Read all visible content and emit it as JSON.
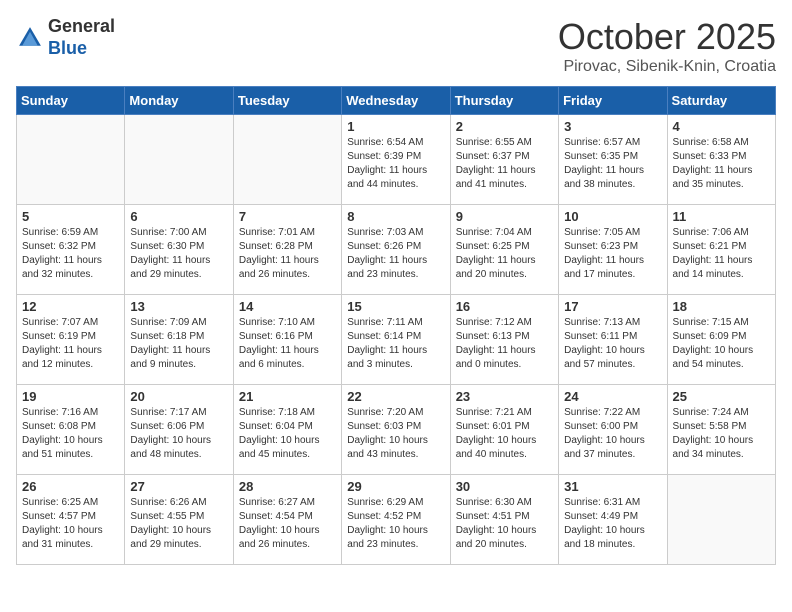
{
  "header": {
    "logo_general": "General",
    "logo_blue": "Blue",
    "month_title": "October 2025",
    "location": "Pirovac, Sibenik-Knin, Croatia"
  },
  "weekdays": [
    "Sunday",
    "Monday",
    "Tuesday",
    "Wednesday",
    "Thursday",
    "Friday",
    "Saturday"
  ],
  "weeks": [
    [
      {
        "day": "",
        "info": ""
      },
      {
        "day": "",
        "info": ""
      },
      {
        "day": "",
        "info": ""
      },
      {
        "day": "1",
        "info": "Sunrise: 6:54 AM\nSunset: 6:39 PM\nDaylight: 11 hours\nand 44 minutes."
      },
      {
        "day": "2",
        "info": "Sunrise: 6:55 AM\nSunset: 6:37 PM\nDaylight: 11 hours\nand 41 minutes."
      },
      {
        "day": "3",
        "info": "Sunrise: 6:57 AM\nSunset: 6:35 PM\nDaylight: 11 hours\nand 38 minutes."
      },
      {
        "day": "4",
        "info": "Sunrise: 6:58 AM\nSunset: 6:33 PM\nDaylight: 11 hours\nand 35 minutes."
      }
    ],
    [
      {
        "day": "5",
        "info": "Sunrise: 6:59 AM\nSunset: 6:32 PM\nDaylight: 11 hours\nand 32 minutes."
      },
      {
        "day": "6",
        "info": "Sunrise: 7:00 AM\nSunset: 6:30 PM\nDaylight: 11 hours\nand 29 minutes."
      },
      {
        "day": "7",
        "info": "Sunrise: 7:01 AM\nSunset: 6:28 PM\nDaylight: 11 hours\nand 26 minutes."
      },
      {
        "day": "8",
        "info": "Sunrise: 7:03 AM\nSunset: 6:26 PM\nDaylight: 11 hours\nand 23 minutes."
      },
      {
        "day": "9",
        "info": "Sunrise: 7:04 AM\nSunset: 6:25 PM\nDaylight: 11 hours\nand 20 minutes."
      },
      {
        "day": "10",
        "info": "Sunrise: 7:05 AM\nSunset: 6:23 PM\nDaylight: 11 hours\nand 17 minutes."
      },
      {
        "day": "11",
        "info": "Sunrise: 7:06 AM\nSunset: 6:21 PM\nDaylight: 11 hours\nand 14 minutes."
      }
    ],
    [
      {
        "day": "12",
        "info": "Sunrise: 7:07 AM\nSunset: 6:19 PM\nDaylight: 11 hours\nand 12 minutes."
      },
      {
        "day": "13",
        "info": "Sunrise: 7:09 AM\nSunset: 6:18 PM\nDaylight: 11 hours\nand 9 minutes."
      },
      {
        "day": "14",
        "info": "Sunrise: 7:10 AM\nSunset: 6:16 PM\nDaylight: 11 hours\nand 6 minutes."
      },
      {
        "day": "15",
        "info": "Sunrise: 7:11 AM\nSunset: 6:14 PM\nDaylight: 11 hours\nand 3 minutes."
      },
      {
        "day": "16",
        "info": "Sunrise: 7:12 AM\nSunset: 6:13 PM\nDaylight: 11 hours\nand 0 minutes."
      },
      {
        "day": "17",
        "info": "Sunrise: 7:13 AM\nSunset: 6:11 PM\nDaylight: 10 hours\nand 57 minutes."
      },
      {
        "day": "18",
        "info": "Sunrise: 7:15 AM\nSunset: 6:09 PM\nDaylight: 10 hours\nand 54 minutes."
      }
    ],
    [
      {
        "day": "19",
        "info": "Sunrise: 7:16 AM\nSunset: 6:08 PM\nDaylight: 10 hours\nand 51 minutes."
      },
      {
        "day": "20",
        "info": "Sunrise: 7:17 AM\nSunset: 6:06 PM\nDaylight: 10 hours\nand 48 minutes."
      },
      {
        "day": "21",
        "info": "Sunrise: 7:18 AM\nSunset: 6:04 PM\nDaylight: 10 hours\nand 45 minutes."
      },
      {
        "day": "22",
        "info": "Sunrise: 7:20 AM\nSunset: 6:03 PM\nDaylight: 10 hours\nand 43 minutes."
      },
      {
        "day": "23",
        "info": "Sunrise: 7:21 AM\nSunset: 6:01 PM\nDaylight: 10 hours\nand 40 minutes."
      },
      {
        "day": "24",
        "info": "Sunrise: 7:22 AM\nSunset: 6:00 PM\nDaylight: 10 hours\nand 37 minutes."
      },
      {
        "day": "25",
        "info": "Sunrise: 7:24 AM\nSunset: 5:58 PM\nDaylight: 10 hours\nand 34 minutes."
      }
    ],
    [
      {
        "day": "26",
        "info": "Sunrise: 6:25 AM\nSunset: 4:57 PM\nDaylight: 10 hours\nand 31 minutes."
      },
      {
        "day": "27",
        "info": "Sunrise: 6:26 AM\nSunset: 4:55 PM\nDaylight: 10 hours\nand 29 minutes."
      },
      {
        "day": "28",
        "info": "Sunrise: 6:27 AM\nSunset: 4:54 PM\nDaylight: 10 hours\nand 26 minutes."
      },
      {
        "day": "29",
        "info": "Sunrise: 6:29 AM\nSunset: 4:52 PM\nDaylight: 10 hours\nand 23 minutes."
      },
      {
        "day": "30",
        "info": "Sunrise: 6:30 AM\nSunset: 4:51 PM\nDaylight: 10 hours\nand 20 minutes."
      },
      {
        "day": "31",
        "info": "Sunrise: 6:31 AM\nSunset: 4:49 PM\nDaylight: 10 hours\nand 18 minutes."
      },
      {
        "day": "",
        "info": ""
      }
    ]
  ]
}
